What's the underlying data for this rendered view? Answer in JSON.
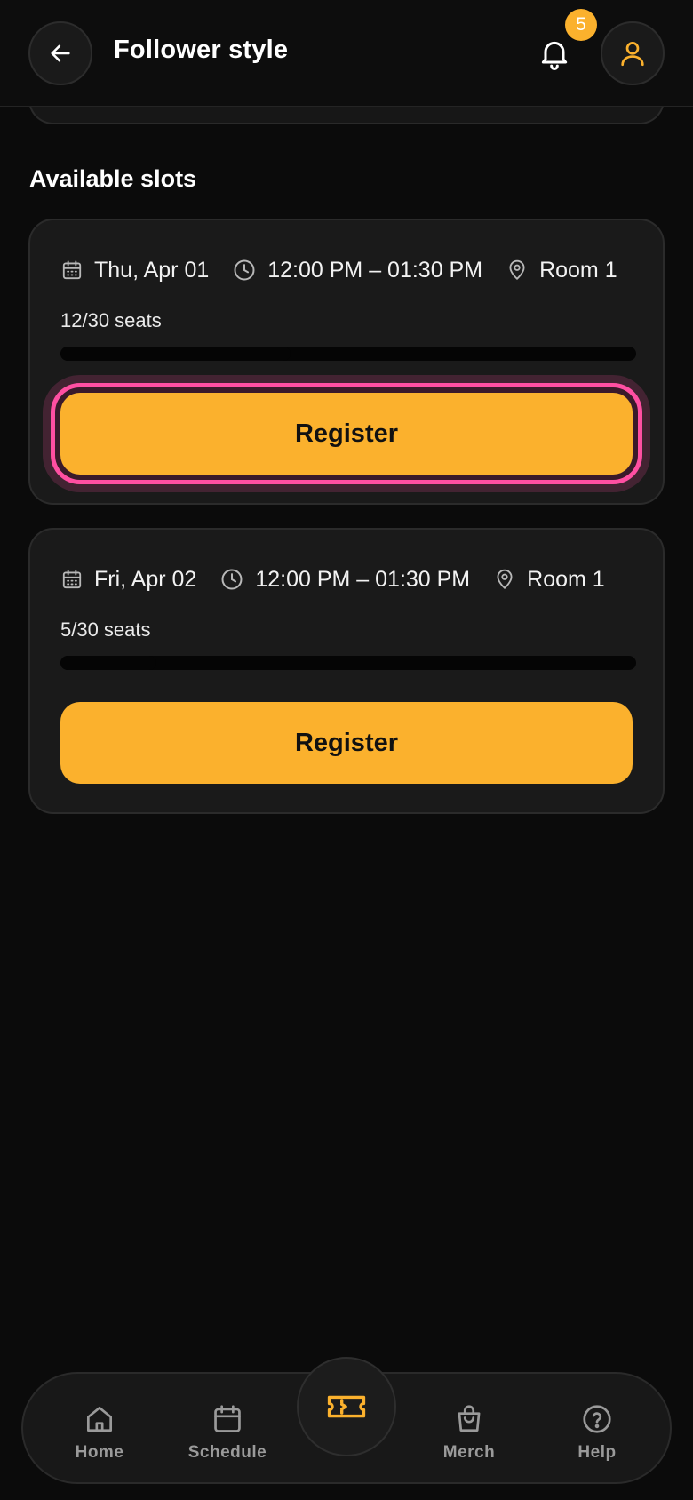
{
  "header": {
    "title": "Follower style",
    "notification_count": "5",
    "back_icon": "arrow-left-icon",
    "bell_icon": "bell-icon",
    "profile_icon": "user-icon"
  },
  "section": {
    "title": "Available slots"
  },
  "slots": [
    {
      "date": "Thu, Apr 01",
      "time": "12:00 PM – 01:30 PM",
      "room": "Room 1",
      "seats": "12/30 seats",
      "seats_taken": 12,
      "seats_total": 30,
      "button": "Register",
      "focused": true
    },
    {
      "date": "Fri, Apr 02",
      "time": "12:00 PM – 01:30 PM",
      "room": "Room 1",
      "seats": "5/30 seats",
      "seats_taken": 5,
      "seats_total": 30,
      "button": "Register",
      "focused": false
    }
  ],
  "nav": {
    "home": "Home",
    "schedule": "Schedule",
    "merch": "Merch",
    "help": "Help",
    "center_icon": "ticket-icon"
  },
  "colors": {
    "accent": "#fbb12d",
    "focus_ring": "#ff4fa2",
    "background": "#0b0b0b",
    "card": "#1a1a1a"
  }
}
